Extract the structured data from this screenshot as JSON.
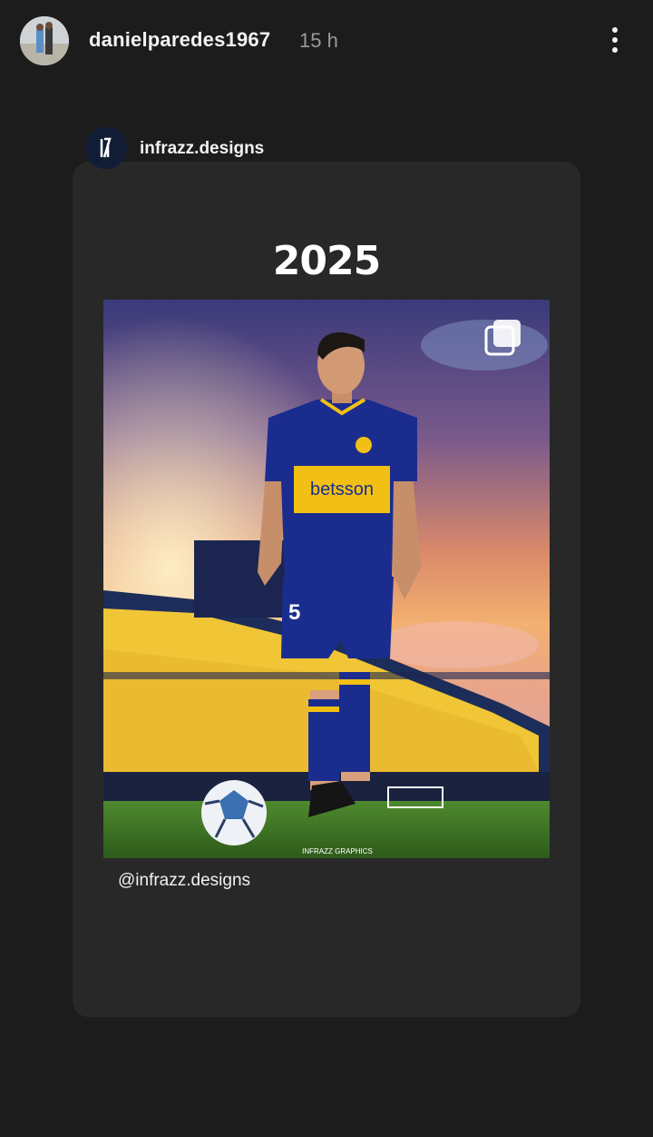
{
  "story": {
    "username": "danielparedes1967",
    "time": "15 h",
    "more_icon": "more-vertical-icon"
  },
  "post": {
    "author": "infrazz.designs",
    "year": "2025",
    "artwork": {
      "sponsor": "betsson",
      "shirt_number": "5",
      "watermark": "INFRAZZ GRAPHICS",
      "colors": {
        "blue": "#1a2d8f",
        "yellow": "#f2c014"
      }
    },
    "caption": "@infrazz.designs"
  }
}
